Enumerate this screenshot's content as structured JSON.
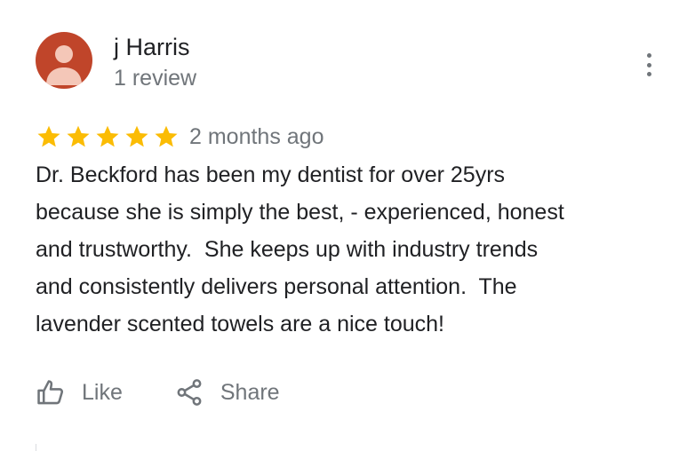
{
  "reviewer": {
    "name": "j Harris",
    "review_count": "1 review",
    "avatar_color": "#c0452a"
  },
  "menu": {
    "icon": "more-vert-icon"
  },
  "rating": {
    "stars": 5,
    "max_stars": 5,
    "star_color": "#fbbc04",
    "time_ago": "2 months ago"
  },
  "review": {
    "lines": [
      "Dr. Beckford has been my dentist for over 25yrs",
      "because she is simply the best, - experienced, honest",
      "and trustworthy.  She keeps up with industry trends",
      "and consistently delivers personal attention.  The",
      "lavender scented towels are a nice touch!"
    ]
  },
  "actions": {
    "like_label": "Like",
    "like_icon": "thumbs-up-icon",
    "share_label": "Share",
    "share_icon": "share-icon"
  },
  "colors": {
    "text_primary": "#202124",
    "text_secondary": "#70757a"
  }
}
